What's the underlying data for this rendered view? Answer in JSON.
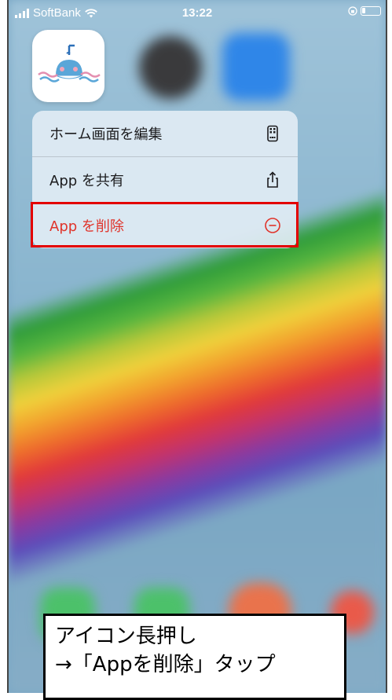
{
  "status_bar": {
    "carrier": "SoftBank",
    "time": "13:22"
  },
  "app": {
    "icon": "whale-app-icon"
  },
  "context_menu": {
    "items": [
      {
        "label": "ホーム画面を編集",
        "icon": "phone-edit-icon"
      },
      {
        "label": "App を共有",
        "icon": "share-icon"
      },
      {
        "label": "App を削除",
        "icon": "minus-circle-icon",
        "destructive": true
      }
    ],
    "destructive_color": "#e0342b"
  },
  "caption": {
    "line1": "アイコン長押し",
    "line2": "→「Appを削除」タップ"
  }
}
